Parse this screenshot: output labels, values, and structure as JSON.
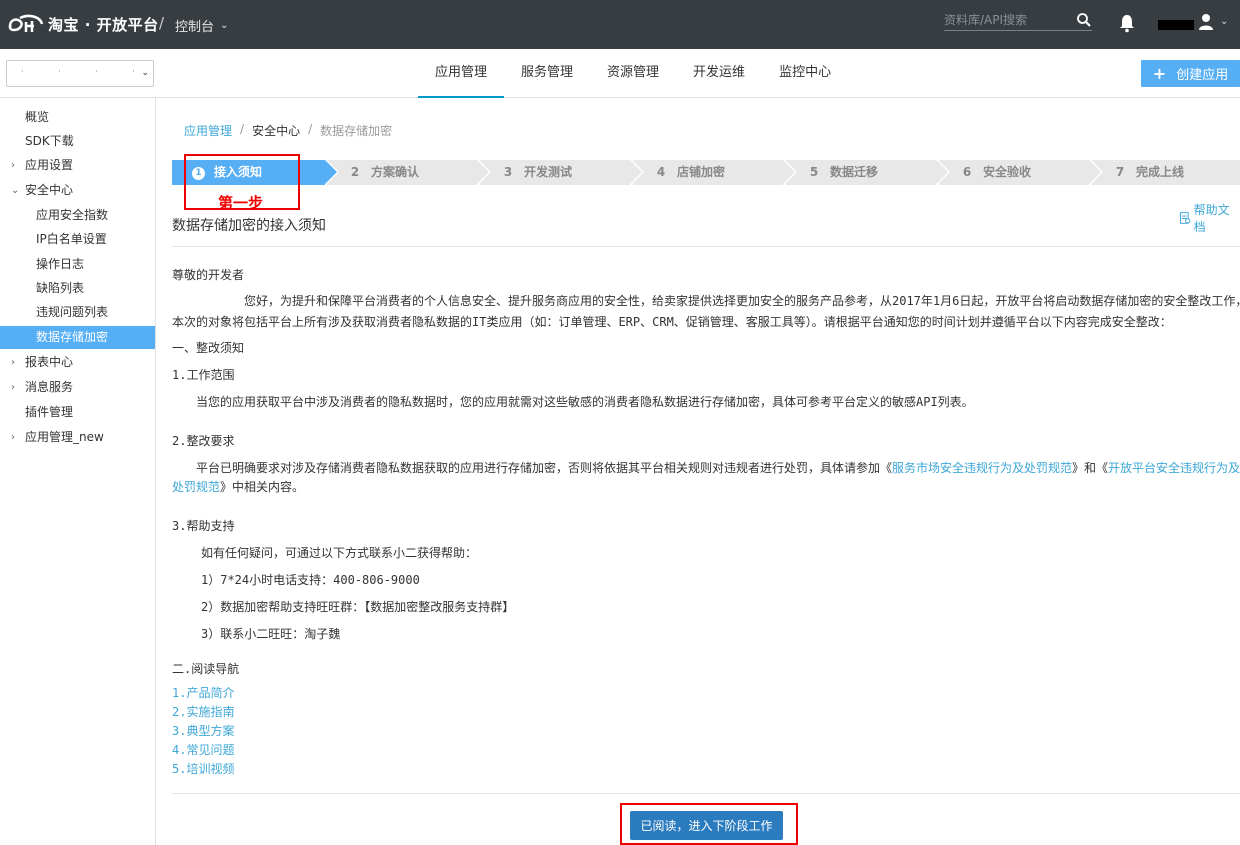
{
  "topbar": {
    "brand": "淘宝 · 开放平台",
    "separator": "/",
    "console_label": "控制台",
    "search_placeholder": "资料库/API搜索"
  },
  "navbar": {
    "app_select_value": "· · · ·",
    "tabs": [
      {
        "label": "应用管理",
        "active": true
      },
      {
        "label": "服务管理",
        "active": false
      },
      {
        "label": "资源管理",
        "active": false
      },
      {
        "label": "开发运维",
        "active": false
      },
      {
        "label": "监控中心",
        "active": false
      }
    ],
    "create_label": "创建应用"
  },
  "sidebar": {
    "items": [
      {
        "label": "概览"
      },
      {
        "label": "SDK下载"
      },
      {
        "label": "应用设置"
      },
      {
        "label": "安全中心"
      },
      {
        "label": "应用安全指数"
      },
      {
        "label": "IP白名单设置"
      },
      {
        "label": "操作日志"
      },
      {
        "label": "缺陷列表"
      },
      {
        "label": "违规问题列表"
      },
      {
        "label": "数据存储加密"
      },
      {
        "label": "报表中心"
      },
      {
        "label": "消息服务"
      },
      {
        "label": "插件管理"
      },
      {
        "label": "应用管理_new"
      }
    ]
  },
  "breadcrumb": [
    "应用管理",
    "安全中心",
    "数据存储加密"
  ],
  "steps": [
    {
      "num": "1",
      "label": "接入须知"
    },
    {
      "num": "2",
      "label": "方案确认"
    },
    {
      "num": "3",
      "label": "开发测试"
    },
    {
      "num": "4",
      "label": "店铺加密"
    },
    {
      "num": "5",
      "label": "数据迁移"
    },
    {
      "num": "6",
      "label": "安全验收"
    },
    {
      "num": "7",
      "label": "完成上线"
    }
  ],
  "annotation": "第一步",
  "help_doc": "帮助文档",
  "page_title": "数据存储加密的接入须知",
  "content": {
    "greeting": "尊敬的开发者",
    "intro_line1": "您好，为提升和保障平台消费者的个人信息安全、提升服务商应用的安全性，给卖家提供选择更加安全的服务产品参考，从2017年1月6日起，开放平台将启动数据存储加密的安全整改工作，",
    "intro_line2": "本次的对象将包括平台上所有涉及获取消费者隐私数据的IT类应用（如：订单管理、ERP、CRM、促销管理、客服工具等）。请根据平台通知您的时间计划并遵循平台以下内容完成安全整改：",
    "section1": "一、整改须知",
    "s1_1_title": "1.工作范围",
    "s1_1_body": "当您的应用获取平台中涉及消费者的隐私数据时，您的应用就需对这些敏感的消费者隐私数据进行存储加密，具体可参考平台定义的敏感API列表。",
    "s1_2_title": "2.整改要求",
    "s1_2_body_a": "平台已明确要求对涉及存储消费者隐私数据获取的应用进行存储加密，否则将依据其平台相关规则对违规者进行处罚，具体请参加《",
    "s1_2_link1": "服务市场安全违规行为及处罚规范",
    "s1_2_body_b": "》和《",
    "s1_2_link2a": "开放平台安全违规行为及",
    "s1_2_link2b": "处罚规范",
    "s1_2_body_c": "》中相关内容。",
    "s1_3_title": "3.帮助支持",
    "s1_3_intro": "如有任何疑问，可通过以下方式联系小二获得帮助：",
    "s1_3_item1": "1）7*24小时电话支持：400-806-9000",
    "s1_3_item2": "2）数据加密帮助支持旺旺群：【数据加密整改服务支持群】",
    "s1_3_item3": "3）联系小二旺旺：淘子魏",
    "section2": "二.阅读导航",
    "nav_links": [
      "1.产品简介",
      "2.实施指南",
      "3.典型方案",
      "4.常见问题",
      "5.培训视频"
    ]
  },
  "next_button": "已阅读，进入下阶段工作",
  "colors": {
    "topbar": "#373d41",
    "accent": "#56aef5",
    "link": "#3ea7d8",
    "primary_button": "#2b7bbf",
    "annotation": "#e00000"
  }
}
